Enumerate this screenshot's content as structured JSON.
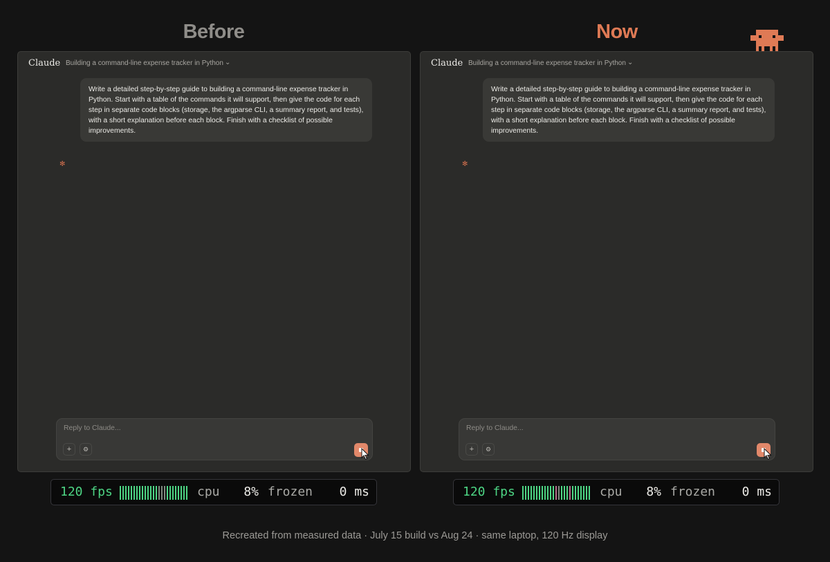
{
  "headings": {
    "before": "Before",
    "now": "Now"
  },
  "colors": {
    "accent": "#df7a55",
    "fps_green": "#4dd584",
    "meter_dim": "#808a80",
    "meter_warn": "#b86f8f",
    "window_bg": "#2b2b29",
    "page_bg": "#141414"
  },
  "mascot_icon": "pixel-robot-icon",
  "panels": [
    {
      "id": "before",
      "app_name": "Claude",
      "conversation_title": "Building a command-line expense tracker in Python",
      "user_message": "Write a detailed step-by-step guide to building a command-line expense tracker in Python. Start with a table of the commands it will support, then give the code for each step in separate code blocks (storage, the argparse CLI, a summary report, and tests), with a short explanation before each block. Finish with a checklist of possible improvements.",
      "spinner_glyph": "✻",
      "composer": {
        "placeholder": "Reply to Claude...",
        "plus_glyph": "+",
        "tools_glyph": "⚙",
        "send_state": "stop"
      },
      "stats": {
        "fps_text": "120 fps",
        "meter": [
          "g",
          "g",
          "g",
          "g",
          "g",
          "g",
          "g",
          "g",
          "g",
          "g",
          "g",
          "g",
          "g",
          "g",
          "d",
          "d",
          "d",
          "g",
          "g",
          "g",
          "g",
          "g",
          "g",
          "g",
          "g"
        ],
        "cpu_label": "cpu",
        "cpu_value": "8%",
        "frozen_label": "frozen",
        "frozen_value": "0 ms"
      }
    },
    {
      "id": "now",
      "app_name": "Claude",
      "conversation_title": "Building a command-line expense tracker in Python",
      "user_message": "Write a detailed step-by-step guide to building a command-line expense tracker in Python. Start with a table of the commands it will support, then give the code for each step in separate code blocks (storage, the argparse CLI, a summary report, and tests), with a short explanation before each block. Finish with a checklist of possible improvements.",
      "spinner_glyph": "✻",
      "composer": {
        "placeholder": "Reply to Claude...",
        "plus_glyph": "+",
        "tools_glyph": "⚙",
        "send_state": "stop"
      },
      "stats": {
        "fps_text": "120 fps",
        "meter": [
          "g",
          "g",
          "g",
          "g",
          "g",
          "g",
          "g",
          "g",
          "g",
          "g",
          "g",
          "g",
          "w",
          "d",
          "g",
          "g",
          "g",
          "w",
          "g",
          "g",
          "g",
          "g",
          "g",
          "g",
          "g"
        ],
        "cpu_label": "cpu",
        "cpu_value": "8%",
        "frozen_label": "frozen",
        "frozen_value": "0 ms"
      }
    }
  ],
  "footer": {
    "caption": "Recreated from measured data · July 15 build vs Aug 24 · same laptop, 120 Hz display"
  }
}
